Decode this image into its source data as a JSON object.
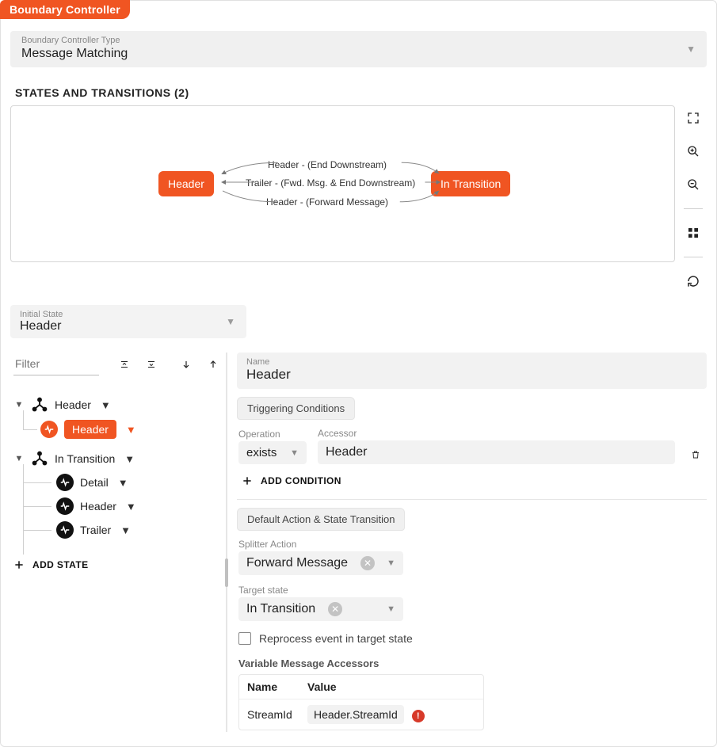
{
  "badge": "Boundary Controller",
  "typeSelector": {
    "label": "Boundary Controller Type",
    "value": "Message Matching"
  },
  "sectionTitle": "STATES AND TRANSITIONS (2)",
  "diagram": {
    "stateA": "Header",
    "stateB": "In Transition",
    "edge1": "Header - (End Downstream)",
    "edge2": "Trailer - (Fwd. Msg. & End Downstream)",
    "edge3": "Header - (Forward Message)"
  },
  "initialState": {
    "label": "Initial State",
    "value": "Header"
  },
  "filter": {
    "placeholder": "Filter"
  },
  "tree": {
    "node_header": "Header",
    "node_header_child": "Header",
    "node_transition": "In Transition",
    "node_detail": "Detail",
    "node_header2": "Header",
    "node_trailer": "Trailer"
  },
  "addState": "ADD STATE",
  "detail": {
    "name": {
      "label": "Name",
      "value": "Header"
    },
    "tabTriggering": "Triggering Conditions",
    "operation": {
      "label": "Operation",
      "value": "exists"
    },
    "accessor": {
      "label": "Accessor",
      "value": "Header"
    },
    "addCondition": "ADD CONDITION",
    "tabAction": "Default Action & State Transition",
    "splitter": {
      "label": "Splitter Action",
      "value": "Forward Message"
    },
    "target": {
      "label": "Target state",
      "value": "In Transition"
    },
    "reprocess": "Reprocess event in target state",
    "vmaTitle": "Variable Message Accessors",
    "vmaHeadName": "Name",
    "vmaHeadValue": "Value",
    "vmaRowName": "StreamId",
    "vmaRowValue": "Header.StreamId"
  }
}
